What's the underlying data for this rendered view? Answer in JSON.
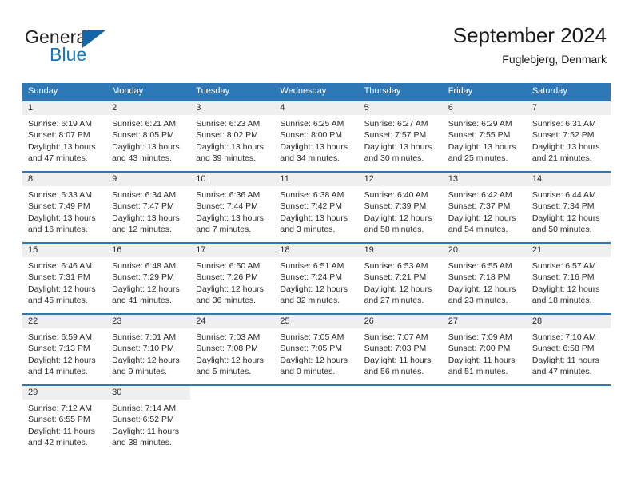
{
  "brand": {
    "name_part1": "General",
    "name_part2": "Blue",
    "accent_color": "#1574bb",
    "triangle_color": "#1566a8"
  },
  "header": {
    "title": "September 2024",
    "subtitle": "Fuglebjerg, Denmark"
  },
  "theme": {
    "header_bg": "#2e78b8",
    "header_text": "#ffffff",
    "datenum_bg": "#efefef",
    "rule_color": "#2e78b8",
    "text_color": "#2b2b2b"
  },
  "weekdays": [
    "Sunday",
    "Monday",
    "Tuesday",
    "Wednesday",
    "Thursday",
    "Friday",
    "Saturday"
  ],
  "weeks": [
    [
      {
        "day": "1",
        "sunrise": "Sunrise: 6:19 AM",
        "sunset": "Sunset: 8:07 PM",
        "daylight1": "Daylight: 13 hours",
        "daylight2": "and 47 minutes."
      },
      {
        "day": "2",
        "sunrise": "Sunrise: 6:21 AM",
        "sunset": "Sunset: 8:05 PM",
        "daylight1": "Daylight: 13 hours",
        "daylight2": "and 43 minutes."
      },
      {
        "day": "3",
        "sunrise": "Sunrise: 6:23 AM",
        "sunset": "Sunset: 8:02 PM",
        "daylight1": "Daylight: 13 hours",
        "daylight2": "and 39 minutes."
      },
      {
        "day": "4",
        "sunrise": "Sunrise: 6:25 AM",
        "sunset": "Sunset: 8:00 PM",
        "daylight1": "Daylight: 13 hours",
        "daylight2": "and 34 minutes."
      },
      {
        "day": "5",
        "sunrise": "Sunrise: 6:27 AM",
        "sunset": "Sunset: 7:57 PM",
        "daylight1": "Daylight: 13 hours",
        "daylight2": "and 30 minutes."
      },
      {
        "day": "6",
        "sunrise": "Sunrise: 6:29 AM",
        "sunset": "Sunset: 7:55 PM",
        "daylight1": "Daylight: 13 hours",
        "daylight2": "and 25 minutes."
      },
      {
        "day": "7",
        "sunrise": "Sunrise: 6:31 AM",
        "sunset": "Sunset: 7:52 PM",
        "daylight1": "Daylight: 13 hours",
        "daylight2": "and 21 minutes."
      }
    ],
    [
      {
        "day": "8",
        "sunrise": "Sunrise: 6:33 AM",
        "sunset": "Sunset: 7:49 PM",
        "daylight1": "Daylight: 13 hours",
        "daylight2": "and 16 minutes."
      },
      {
        "day": "9",
        "sunrise": "Sunrise: 6:34 AM",
        "sunset": "Sunset: 7:47 PM",
        "daylight1": "Daylight: 13 hours",
        "daylight2": "and 12 minutes."
      },
      {
        "day": "10",
        "sunrise": "Sunrise: 6:36 AM",
        "sunset": "Sunset: 7:44 PM",
        "daylight1": "Daylight: 13 hours",
        "daylight2": "and 7 minutes."
      },
      {
        "day": "11",
        "sunrise": "Sunrise: 6:38 AM",
        "sunset": "Sunset: 7:42 PM",
        "daylight1": "Daylight: 13 hours",
        "daylight2": "and 3 minutes."
      },
      {
        "day": "12",
        "sunrise": "Sunrise: 6:40 AM",
        "sunset": "Sunset: 7:39 PM",
        "daylight1": "Daylight: 12 hours",
        "daylight2": "and 58 minutes."
      },
      {
        "day": "13",
        "sunrise": "Sunrise: 6:42 AM",
        "sunset": "Sunset: 7:37 PM",
        "daylight1": "Daylight: 12 hours",
        "daylight2": "and 54 minutes."
      },
      {
        "day": "14",
        "sunrise": "Sunrise: 6:44 AM",
        "sunset": "Sunset: 7:34 PM",
        "daylight1": "Daylight: 12 hours",
        "daylight2": "and 50 minutes."
      }
    ],
    [
      {
        "day": "15",
        "sunrise": "Sunrise: 6:46 AM",
        "sunset": "Sunset: 7:31 PM",
        "daylight1": "Daylight: 12 hours",
        "daylight2": "and 45 minutes."
      },
      {
        "day": "16",
        "sunrise": "Sunrise: 6:48 AM",
        "sunset": "Sunset: 7:29 PM",
        "daylight1": "Daylight: 12 hours",
        "daylight2": "and 41 minutes."
      },
      {
        "day": "17",
        "sunrise": "Sunrise: 6:50 AM",
        "sunset": "Sunset: 7:26 PM",
        "daylight1": "Daylight: 12 hours",
        "daylight2": "and 36 minutes."
      },
      {
        "day": "18",
        "sunrise": "Sunrise: 6:51 AM",
        "sunset": "Sunset: 7:24 PM",
        "daylight1": "Daylight: 12 hours",
        "daylight2": "and 32 minutes."
      },
      {
        "day": "19",
        "sunrise": "Sunrise: 6:53 AM",
        "sunset": "Sunset: 7:21 PM",
        "daylight1": "Daylight: 12 hours",
        "daylight2": "and 27 minutes."
      },
      {
        "day": "20",
        "sunrise": "Sunrise: 6:55 AM",
        "sunset": "Sunset: 7:18 PM",
        "daylight1": "Daylight: 12 hours",
        "daylight2": "and 23 minutes."
      },
      {
        "day": "21",
        "sunrise": "Sunrise: 6:57 AM",
        "sunset": "Sunset: 7:16 PM",
        "daylight1": "Daylight: 12 hours",
        "daylight2": "and 18 minutes."
      }
    ],
    [
      {
        "day": "22",
        "sunrise": "Sunrise: 6:59 AM",
        "sunset": "Sunset: 7:13 PM",
        "daylight1": "Daylight: 12 hours",
        "daylight2": "and 14 minutes."
      },
      {
        "day": "23",
        "sunrise": "Sunrise: 7:01 AM",
        "sunset": "Sunset: 7:10 PM",
        "daylight1": "Daylight: 12 hours",
        "daylight2": "and 9 minutes."
      },
      {
        "day": "24",
        "sunrise": "Sunrise: 7:03 AM",
        "sunset": "Sunset: 7:08 PM",
        "daylight1": "Daylight: 12 hours",
        "daylight2": "and 5 minutes."
      },
      {
        "day": "25",
        "sunrise": "Sunrise: 7:05 AM",
        "sunset": "Sunset: 7:05 PM",
        "daylight1": "Daylight: 12 hours",
        "daylight2": "and 0 minutes."
      },
      {
        "day": "26",
        "sunrise": "Sunrise: 7:07 AM",
        "sunset": "Sunset: 7:03 PM",
        "daylight1": "Daylight: 11 hours",
        "daylight2": "and 56 minutes."
      },
      {
        "day": "27",
        "sunrise": "Sunrise: 7:09 AM",
        "sunset": "Sunset: 7:00 PM",
        "daylight1": "Daylight: 11 hours",
        "daylight2": "and 51 minutes."
      },
      {
        "day": "28",
        "sunrise": "Sunrise: 7:10 AM",
        "sunset": "Sunset: 6:58 PM",
        "daylight1": "Daylight: 11 hours",
        "daylight2": "and 47 minutes."
      }
    ],
    [
      {
        "day": "29",
        "sunrise": "Sunrise: 7:12 AM",
        "sunset": "Sunset: 6:55 PM",
        "daylight1": "Daylight: 11 hours",
        "daylight2": "and 42 minutes."
      },
      {
        "day": "30",
        "sunrise": "Sunrise: 7:14 AM",
        "sunset": "Sunset: 6:52 PM",
        "daylight1": "Daylight: 11 hours",
        "daylight2": "and 38 minutes."
      },
      {
        "day": "",
        "sunrise": "",
        "sunset": "",
        "daylight1": "",
        "daylight2": ""
      },
      {
        "day": "",
        "sunrise": "",
        "sunset": "",
        "daylight1": "",
        "daylight2": ""
      },
      {
        "day": "",
        "sunrise": "",
        "sunset": "",
        "daylight1": "",
        "daylight2": ""
      },
      {
        "day": "",
        "sunrise": "",
        "sunset": "",
        "daylight1": "",
        "daylight2": ""
      },
      {
        "day": "",
        "sunrise": "",
        "sunset": "",
        "daylight1": "",
        "daylight2": ""
      }
    ]
  ]
}
